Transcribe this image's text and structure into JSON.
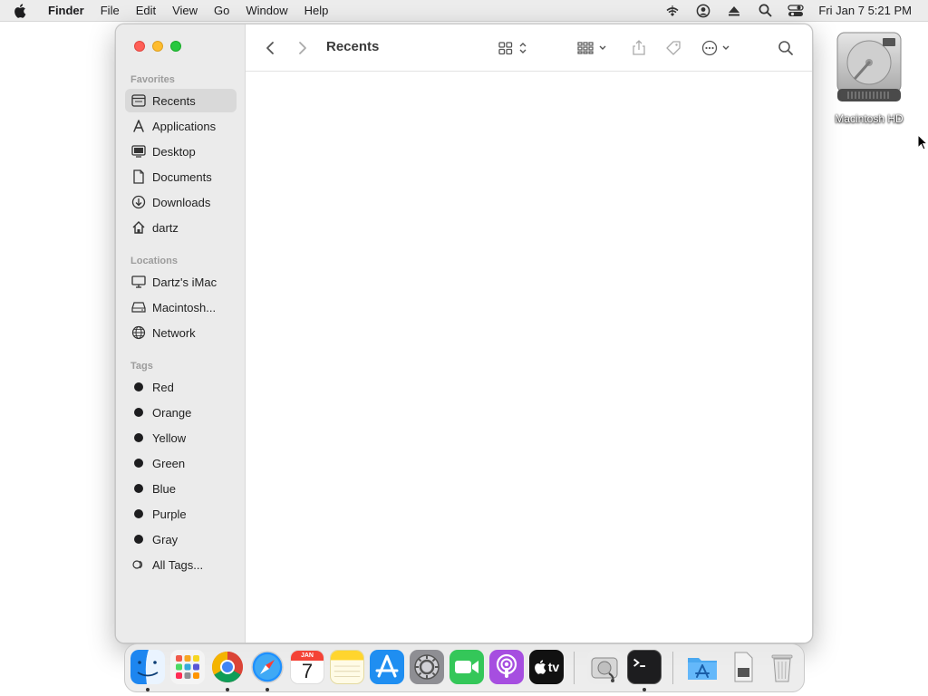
{
  "menubar": {
    "apple_icon": "apple-logo",
    "app_name": "Finder",
    "menus": [
      "File",
      "Edit",
      "View",
      "Go",
      "Window",
      "Help"
    ],
    "status_icons": [
      "wifi-icon",
      "user-account-icon",
      "eject-icon",
      "spotlight-search-icon",
      "control-center-icon"
    ],
    "clock": "Fri Jan 7  5:21 PM"
  },
  "desktop": {
    "icons": [
      {
        "label": "Macintosh HD",
        "icon": "hard-drive-icon"
      }
    ]
  },
  "window": {
    "title": "Recents",
    "sidebar": {
      "favorites_heading": "Favorites",
      "favorites": [
        {
          "label": "Recents",
          "icon": "clock-icon",
          "selected": true
        },
        {
          "label": "Applications",
          "icon": "applications-icon"
        },
        {
          "label": "Desktop",
          "icon": "desktop-icon"
        },
        {
          "label": "Documents",
          "icon": "document-icon"
        },
        {
          "label": "Downloads",
          "icon": "download-icon"
        },
        {
          "label": "dartz",
          "icon": "home-icon"
        }
      ],
      "locations_heading": "Locations",
      "locations": [
        {
          "label": "Dartz's iMac",
          "icon": "imac-icon"
        },
        {
          "label": "Macintosh...",
          "icon": "disk-icon"
        },
        {
          "label": "Network",
          "icon": "network-icon"
        }
      ],
      "tags_heading": "Tags",
      "tags": [
        {
          "label": "Red",
          "color": "#1d1d1f"
        },
        {
          "label": "Orange",
          "color": "#1d1d1f"
        },
        {
          "label": "Yellow",
          "color": "#1d1d1f"
        },
        {
          "label": "Green",
          "color": "#1d1d1f"
        },
        {
          "label": "Blue",
          "color": "#1d1d1f"
        },
        {
          "label": "Purple",
          "color": "#1d1d1f"
        },
        {
          "label": "Gray",
          "color": "#1d1d1f"
        }
      ],
      "all_tags": "All Tags..."
    },
    "toolbar_icons": [
      "back-icon",
      "forward-icon",
      "icon-view-icon",
      "group-icon",
      "share-icon",
      "tag-icon",
      "more-actions-icon",
      "search-icon"
    ]
  },
  "dock": {
    "apps": [
      {
        "name": "Finder",
        "running": true
      },
      {
        "name": "Launchpad",
        "running": false
      },
      {
        "name": "Google Chrome",
        "running": true
      },
      {
        "name": "Safari",
        "running": true
      },
      {
        "name": "Calendar",
        "running": false,
        "month": "JAN",
        "day": "7"
      },
      {
        "name": "Notes",
        "running": false
      },
      {
        "name": "App Store",
        "running": false
      },
      {
        "name": "System Preferences",
        "running": false
      },
      {
        "name": "FaceTime",
        "running": false
      },
      {
        "name": "Podcasts",
        "running": false
      },
      {
        "name": "Apple TV",
        "running": false,
        "label": "tv"
      },
      {
        "name": "Disk Utility",
        "running": false
      },
      {
        "name": "Terminal",
        "running": true
      },
      {
        "name": "Applications Folder",
        "running": false
      },
      {
        "name": "Downloads Stack",
        "running": false
      },
      {
        "name": "Trash",
        "running": false
      }
    ]
  }
}
